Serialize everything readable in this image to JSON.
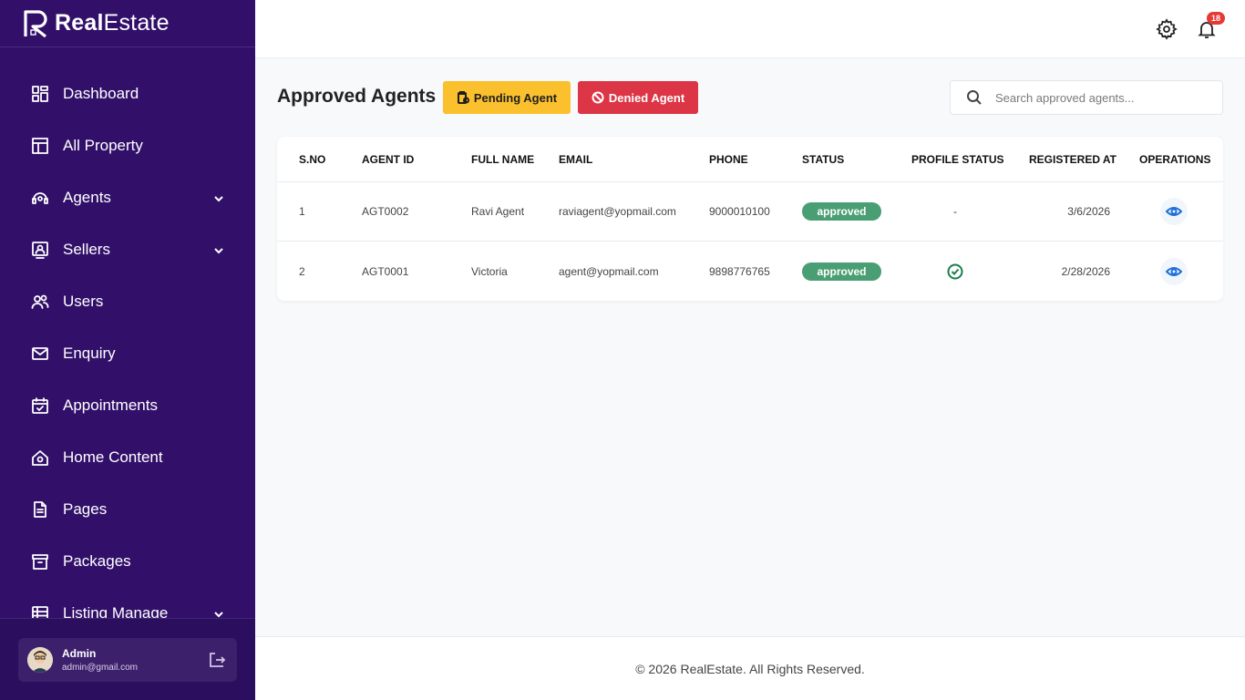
{
  "brand": {
    "name_bold": "Real",
    "name_light": "Estate"
  },
  "sidebar": {
    "items": [
      {
        "label": "Dashboard",
        "icon": "dashboard-icon"
      },
      {
        "label": "All Property",
        "icon": "building-icon"
      },
      {
        "label": "Agents",
        "icon": "agent-headset-icon",
        "has_submenu": true
      },
      {
        "label": "Sellers",
        "icon": "seller-id-icon",
        "has_submenu": true
      },
      {
        "label": "Users",
        "icon": "users-icon"
      },
      {
        "label": "Enquiry",
        "icon": "mail-icon"
      },
      {
        "label": "Appointments",
        "icon": "calendar-check-icon"
      },
      {
        "label": "Home Content",
        "icon": "home-icon"
      },
      {
        "label": "Pages",
        "icon": "document-icon"
      },
      {
        "label": "Packages",
        "icon": "archive-icon"
      },
      {
        "label": "Listing Manage",
        "icon": "list-icon",
        "has_submenu": true
      }
    ],
    "user": {
      "name": "Admin",
      "email": "admin@gmail.com"
    }
  },
  "topbar": {
    "notification_count": "18"
  },
  "main": {
    "title": "Approved Agents",
    "pending_button": "Pending Agent",
    "denied_button": "Denied Agent",
    "search": {
      "placeholder": "Search approved agents..."
    }
  },
  "table": {
    "columns": [
      "S.NO",
      "AGENT ID",
      "FULL NAME",
      "EMAIL",
      "PHONE",
      "STATUS",
      "PROFILE STATUS",
      "REGISTERED AT",
      "OPERATIONS"
    ],
    "rows": [
      {
        "sno": "1",
        "agent_id": "AGT0002",
        "full_name": "Ravi Agent",
        "email": "raviagent@yopmail.com",
        "phone": "9000010100",
        "status": "approved",
        "profile_status": "-",
        "registered_at": "3/6/2026"
      },
      {
        "sno": "2",
        "agent_id": "AGT0001",
        "full_name": "Victoria",
        "email": "agent@yopmail.com",
        "phone": "9898776765",
        "status": "approved",
        "profile_status": "check-icon",
        "registered_at": "2/28/2026"
      }
    ]
  },
  "footer": {
    "text": "© 2026 RealEstate. All Rights Reserved."
  },
  "colors": {
    "sidebar": "#32106a",
    "pending": "#fbc02d",
    "denied": "#dc3545",
    "approved": "#4a9e73",
    "accent": "#1e6fd9"
  }
}
